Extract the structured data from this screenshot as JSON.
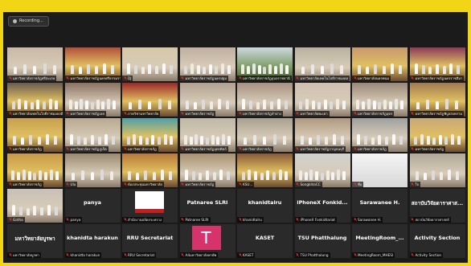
{
  "recording": {
    "label": "Recording..."
  },
  "colors": {
    "frame": "#f2d616",
    "background": "#1b1b1b",
    "avatar": "#d6336c"
  },
  "tiles": [
    {
      "name": "มหาวิทยาลัยราชภัฏศรีสะเกษ",
      "scene": "hall",
      "bg": "#c9b8a6"
    },
    {
      "name": "มหาวิทยาลัยราชภัฏนครศรีธรรมราช",
      "scene": "stage",
      "bg": "#b0503a"
    },
    {
      "name": "DJ",
      "scene": "hall",
      "bg": "#d8c8a8"
    },
    {
      "name": "มหาวิทยาลัยราชภัฏนครปฐม",
      "scene": "hall",
      "bg": "#c0b0a0"
    },
    {
      "name": "มหาวิทยาลัยราชภัฏอุบลราชธานี",
      "scene": "garden",
      "bg": "#7a9a60"
    },
    {
      "name": "มหาวิทยาลัยเทคโนโลยีราชมงคล",
      "scene": "hall",
      "bg": "#b8b0a0"
    },
    {
      "name": "มหาวิทยาลัยนครพนม",
      "scene": "stage",
      "bg": "#c89870"
    },
    {
      "name": "มหาวิทยาลัยราชภัฏนครราชสีมา",
      "scene": "stage",
      "bg": "#8a3a5a"
    },
    {
      "name": "มหาวิทยาลัยเทคโนโลยีราชมงคลอีสาน",
      "scene": "stage",
      "bg": "#6a5a50"
    },
    {
      "name": "มหาวิทยาลัยราชภัฏเลย",
      "scene": "hall",
      "bg": "#8a7060"
    },
    {
      "name": "ภาควิชามหาวิทยาลัย",
      "scene": "stage",
      "bg": "#9a2828"
    },
    {
      "name": "มหาวิทยาลัยราชภัฏ",
      "scene": "hall",
      "bg": "#b0a090"
    },
    {
      "name": "มหาวิทยาลัยราชภัฏลำปาง",
      "scene": "hall",
      "bg": "#a89080"
    },
    {
      "name": "มหาวิทยาลัยพะเยา",
      "scene": "hall",
      "bg": "#d0c0b0"
    },
    {
      "name": "มหาวิทยาลัยราชภัฏอุดร",
      "scene": "hall",
      "bg": "#9a8878"
    },
    {
      "name": "มหาวิทยาลัยราชภัฏพิบูลสงคราม",
      "scene": "stage",
      "bg": "#a07a50"
    },
    {
      "name": "มหาวิทยาลัยราชภัฏ",
      "scene": "stage",
      "bg": "#c8a050"
    },
    {
      "name": "มหาวิทยาลัยราชภัฏภูเก็ต",
      "scene": "hall",
      "bg": "#b8a890"
    },
    {
      "name": "มหาวิทยาลัยราชภัฏ",
      "scene": "stage",
      "bg": "#50a0a8"
    },
    {
      "name": "มหาวิทยาลัยราชภัฏอุตรดิตถ์",
      "scene": "hall",
      "bg": "#c0b8a8"
    },
    {
      "name": "มหาวิทยาลัยราชภัฏ",
      "scene": "hall",
      "bg": "#a8a090"
    },
    {
      "name": "มหาวิทยาลัยราชภัฏกาญจนบุรี",
      "scene": "hall",
      "bg": "#b09880"
    },
    {
      "name": "มหาวิทยาลัยราชภัฏ",
      "scene": "hall",
      "bg": "#a0a0a0"
    },
    {
      "name": "มหาวิทยาลัยราชภัฏ",
      "scene": "stage",
      "bg": "#c8a878"
    },
    {
      "name": "มหาวิทยาลัยราชภัฏ",
      "scene": "stage",
      "bg": "#c89848"
    },
    {
      "name": "Ulu",
      "scene": "hall",
      "bg": "#9a8a70"
    },
    {
      "name": "ห้องประชุมมหาวิทยาลัย",
      "scene": "stage",
      "bg": "#b87838"
    },
    {
      "name": "มหาวิทยาลัยราชภัฏ",
      "scene": "hall",
      "bg": "#a89070"
    },
    {
      "name": "KSU...",
      "scene": "stage",
      "bg": "#8a5a38"
    },
    {
      "name": "SongkhlaCC",
      "scene": "hall",
      "bg": "#d0d0d0"
    },
    {
      "name": "ชื่อ",
      "scene": "blank",
      "bg": "#e8e8e8"
    },
    {
      "name": "ใจ",
      "scene": "hall",
      "bg": "#b0a898"
    },
    {
      "name": "Gotha",
      "scene": "hall",
      "bg": "#c8c0b8"
    },
    {
      "name": "panya",
      "text": "panya"
    },
    {
      "name": "สำนักงานปลัดกระทรวง",
      "scene": "slide",
      "bg": "#2a2a2a"
    },
    {
      "name": "Patnaree SLRI",
      "text": "Patnaree SLRI"
    },
    {
      "name": "khanidtalru",
      "text": "khanidtalru"
    },
    {
      "name": "iPhoneX Fonkidtariat",
      "text": "iPhoneX  Fonkid..."
    },
    {
      "name": "Sarawanee H.",
      "text": "Sarawanee H."
    },
    {
      "name": "สถาบันวิจัยดาราศาสตร์",
      "text": "สถาบันวิจัยดาราศาส..."
    },
    {
      "name": "มหาวิทยาลัยบูรพา",
      "text": "มหาวิทยาลัยบูรพา"
    },
    {
      "name": "khanidta harakun",
      "text": "khanidta harakun"
    },
    {
      "name": "RRU Secretariat",
      "text": "RRU Secretariat"
    },
    {
      "name": "A4มหาวิทยาลัยพายัพ",
      "avatar": "T"
    },
    {
      "name": "KASET",
      "text": "KASET"
    },
    {
      "name": "TSU Phatthalung",
      "text": "TSU Phatthalung"
    },
    {
      "name": "MeetingRoom_MHESI",
      "text": "MeetingRoom_..."
    },
    {
      "name": "Activity Section",
      "text": "Activity Section"
    }
  ]
}
